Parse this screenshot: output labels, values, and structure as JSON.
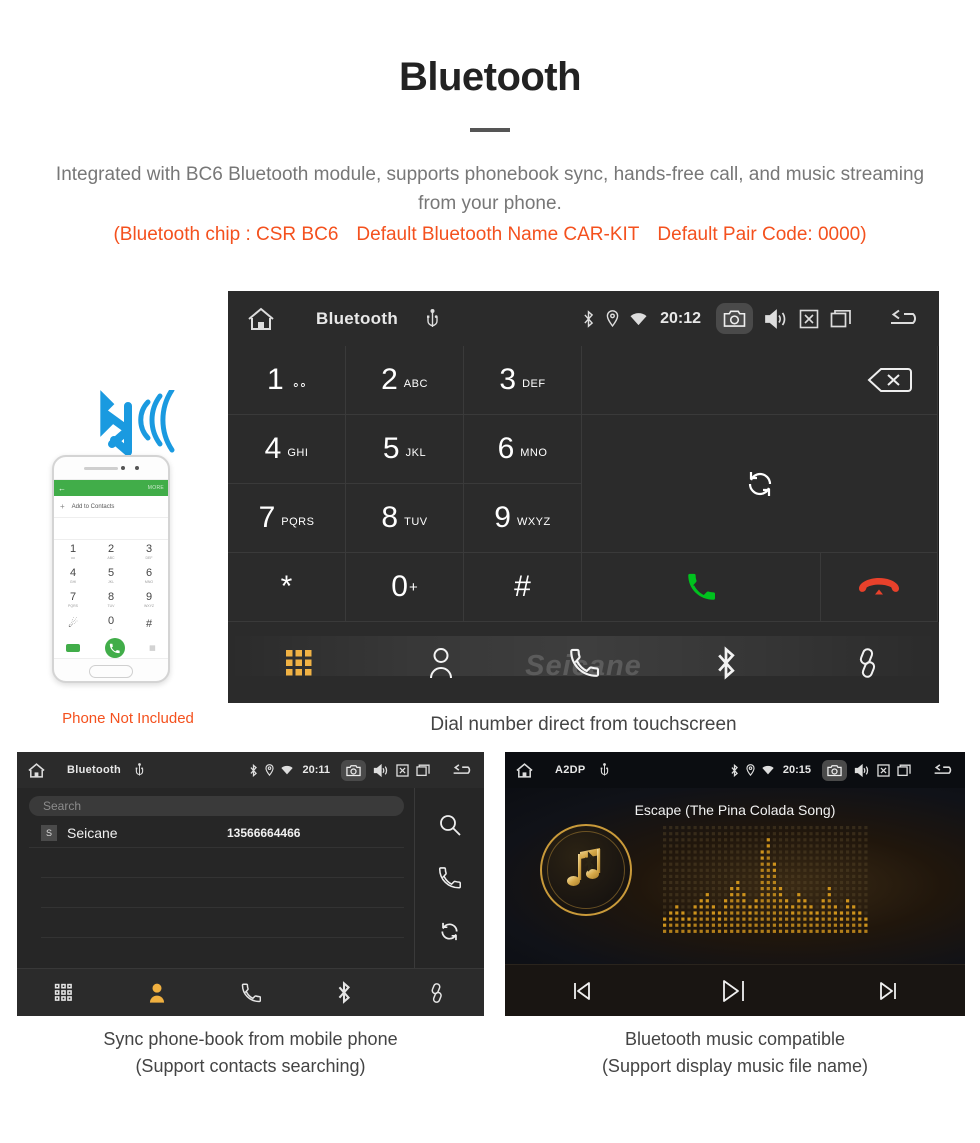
{
  "header": {
    "title": "Bluetooth",
    "description": "Integrated with BC6 Bluetooth module, supports phonebook sync, hands-free call, and music streaming from your phone.",
    "spec_chip": "(Bluetooth chip : CSR BC6",
    "spec_name": "Default Bluetooth Name CAR-KIT",
    "spec_code": "Default Pair Code: 0000)",
    "accent_color": "#f4511e",
    "text_color": "#777777"
  },
  "dialer": {
    "status": {
      "title": "Bluetooth",
      "time": "20:12",
      "icons": [
        "home-icon",
        "usb-icon",
        "bluetooth-icon",
        "location-icon",
        "wifi-icon",
        "camera-icon",
        "volume-icon",
        "close-box-icon",
        "recents-icon",
        "back-icon"
      ]
    },
    "keys": [
      {
        "digit": "1",
        "letters": "",
        "voicemail": true
      },
      {
        "digit": "2",
        "letters": "ABC"
      },
      {
        "digit": "3",
        "letters": "DEF"
      },
      {
        "digit": "4",
        "letters": "GHI"
      },
      {
        "digit": "5",
        "letters": "JKL"
      },
      {
        "digit": "6",
        "letters": "MNO"
      },
      {
        "digit": "7",
        "letters": "PQRS"
      },
      {
        "digit": "8",
        "letters": "TUV"
      },
      {
        "digit": "9",
        "letters": "WXYZ"
      },
      {
        "digit": "*",
        "letters": ""
      },
      {
        "digit": "0",
        "letters": "",
        "plus": "+"
      },
      {
        "digit": "#",
        "letters": ""
      }
    ],
    "actions": {
      "backspace": "backspace-icon",
      "sync": "sync-icon",
      "call": "call-button",
      "hangup": "hangup-button",
      "call_color": "#00c21e",
      "hangup_color": "#e8412b"
    },
    "nav": [
      {
        "name": "keypad",
        "active": true
      },
      {
        "name": "contacts",
        "active": false
      },
      {
        "name": "call-log",
        "active": false
      },
      {
        "name": "bluetooth",
        "active": false
      },
      {
        "name": "link",
        "active": false
      }
    ],
    "active_color": "#f0b040",
    "watermark": "Seicane",
    "caption": "Dial number direct from touchscreen"
  },
  "phone_illustration": {
    "green_more": "MORE",
    "add_contacts": "Add to Contacts",
    "keys": [
      {
        "d": "1",
        "l": "oo"
      },
      {
        "d": "2",
        "l": "ABC"
      },
      {
        "d": "3",
        "l": "DEF"
      },
      {
        "d": "4",
        "l": "GHI"
      },
      {
        "d": "5",
        "l": "JKL"
      },
      {
        "d": "6",
        "l": "MNO"
      },
      {
        "d": "7",
        "l": "PQRS"
      },
      {
        "d": "8",
        "l": "TUV"
      },
      {
        "d": "9",
        "l": "WXYZ"
      },
      {
        "d": "*",
        "l": ""
      },
      {
        "d": "0",
        "l": "+"
      },
      {
        "d": "#",
        "l": ""
      }
    ],
    "caption": "Phone Not Included",
    "caption_color": "#f4511e",
    "bluetooth_color": "#1a9ae0"
  },
  "phonebook": {
    "status": {
      "title": "Bluetooth",
      "time": "20:11"
    },
    "search_placeholder": "Search",
    "contacts": [
      {
        "badge": "S",
        "name": "Seicane",
        "number": "13566664466"
      }
    ],
    "side_actions": [
      "search-icon",
      "call-icon",
      "sync-icon"
    ],
    "nav": [
      {
        "name": "keypad",
        "active": false
      },
      {
        "name": "contacts",
        "active": true
      },
      {
        "name": "call-log",
        "active": false
      },
      {
        "name": "bluetooth",
        "active": false
      },
      {
        "name": "link",
        "active": false
      }
    ],
    "caption_line1": "Sync phone-book from mobile phone",
    "caption_line2": "(Support contacts searching)"
  },
  "music": {
    "status": {
      "title": "A2DP",
      "time": "20:15"
    },
    "track": "Escape (The Pina Colada Song)",
    "controls": [
      "previous-button",
      "play-pause-button",
      "next-button"
    ],
    "accent_color": "#c99a3a",
    "caption_line1": "Bluetooth music compatible",
    "caption_line2": "(Support display music file name)"
  }
}
